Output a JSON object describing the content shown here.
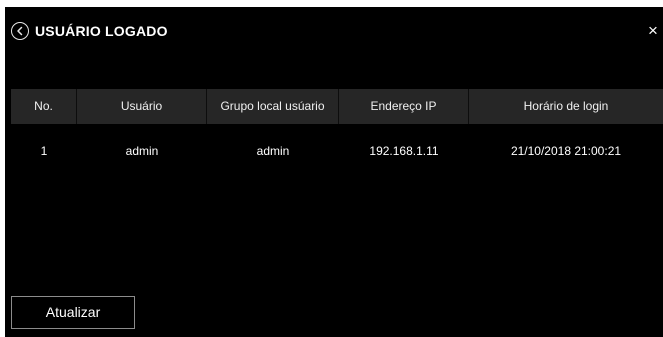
{
  "dialog": {
    "title": "USUÁRIO LOGADO",
    "close_label": "×",
    "back_icon": "chevron-left-circle-icon"
  },
  "table": {
    "columns": [
      "No.",
      "Usuário",
      "Grupo local usúario",
      "Endereço IP",
      "Horário de login"
    ],
    "rows": [
      [
        "1",
        "admin",
        "admin",
        "192.168.1.11",
        "21/10/2018 21:00:21"
      ]
    ]
  },
  "footer": {
    "refresh_label": "Atualizar"
  }
}
